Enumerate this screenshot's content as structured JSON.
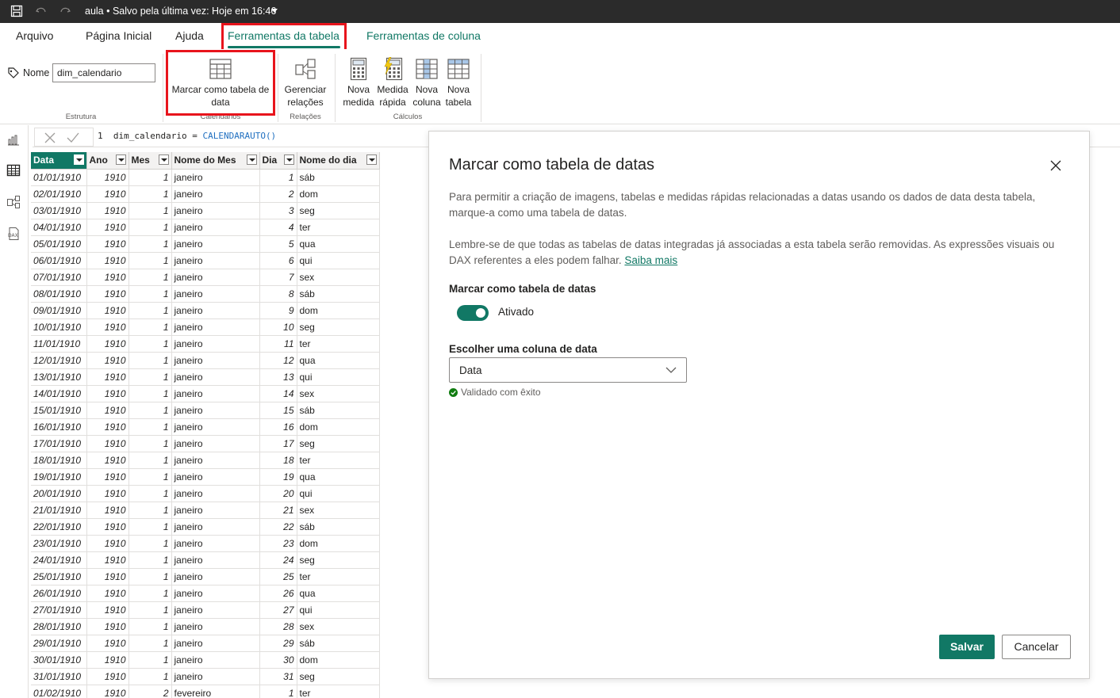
{
  "titlebar": {
    "title": "aula • Salvo pela última vez: Hoje em 16:46"
  },
  "tabs": [
    {
      "label": "Arquivo"
    },
    {
      "label": "Página Inicial"
    },
    {
      "label": "Ajuda"
    },
    {
      "label": "Ferramentas da tabela"
    },
    {
      "label": "Ferramentas de coluna"
    }
  ],
  "ribbon": {
    "name_label": "Nome",
    "name_value": "dim_calendario",
    "groups": {
      "estrutura": "Estrutura",
      "calendarios": "Calendários",
      "relacoes": "Relações",
      "calculos": "Cálculos"
    },
    "buttons": {
      "mark_date": "Marcar como tabela de data",
      "manage_rel": "Gerenciar relações",
      "new_measure": "Nova medida",
      "quick_measure": "Medida rápida",
      "new_column": "Nova coluna",
      "new_table": "Nova tabela"
    }
  },
  "formula": {
    "line": "1",
    "text": "dim_calendario = ",
    "fn": "CALENDARAUTO()"
  },
  "grid": {
    "columns": [
      "Data",
      "Ano",
      "Mes",
      "Nome do Mes",
      "Dia",
      "Nome do dia"
    ],
    "rows": [
      [
        "01/01/1910",
        "1910",
        "1",
        "janeiro",
        "1",
        "sáb"
      ],
      [
        "02/01/1910",
        "1910",
        "1",
        "janeiro",
        "2",
        "dom"
      ],
      [
        "03/01/1910",
        "1910",
        "1",
        "janeiro",
        "3",
        "seg"
      ],
      [
        "04/01/1910",
        "1910",
        "1",
        "janeiro",
        "4",
        "ter"
      ],
      [
        "05/01/1910",
        "1910",
        "1",
        "janeiro",
        "5",
        "qua"
      ],
      [
        "06/01/1910",
        "1910",
        "1",
        "janeiro",
        "6",
        "qui"
      ],
      [
        "07/01/1910",
        "1910",
        "1",
        "janeiro",
        "7",
        "sex"
      ],
      [
        "08/01/1910",
        "1910",
        "1",
        "janeiro",
        "8",
        "sáb"
      ],
      [
        "09/01/1910",
        "1910",
        "1",
        "janeiro",
        "9",
        "dom"
      ],
      [
        "10/01/1910",
        "1910",
        "1",
        "janeiro",
        "10",
        "seg"
      ],
      [
        "11/01/1910",
        "1910",
        "1",
        "janeiro",
        "11",
        "ter"
      ],
      [
        "12/01/1910",
        "1910",
        "1",
        "janeiro",
        "12",
        "qua"
      ],
      [
        "13/01/1910",
        "1910",
        "1",
        "janeiro",
        "13",
        "qui"
      ],
      [
        "14/01/1910",
        "1910",
        "1",
        "janeiro",
        "14",
        "sex"
      ],
      [
        "15/01/1910",
        "1910",
        "1",
        "janeiro",
        "15",
        "sáb"
      ],
      [
        "16/01/1910",
        "1910",
        "1",
        "janeiro",
        "16",
        "dom"
      ],
      [
        "17/01/1910",
        "1910",
        "1",
        "janeiro",
        "17",
        "seg"
      ],
      [
        "18/01/1910",
        "1910",
        "1",
        "janeiro",
        "18",
        "ter"
      ],
      [
        "19/01/1910",
        "1910",
        "1",
        "janeiro",
        "19",
        "qua"
      ],
      [
        "20/01/1910",
        "1910",
        "1",
        "janeiro",
        "20",
        "qui"
      ],
      [
        "21/01/1910",
        "1910",
        "1",
        "janeiro",
        "21",
        "sex"
      ],
      [
        "22/01/1910",
        "1910",
        "1",
        "janeiro",
        "22",
        "sáb"
      ],
      [
        "23/01/1910",
        "1910",
        "1",
        "janeiro",
        "23",
        "dom"
      ],
      [
        "24/01/1910",
        "1910",
        "1",
        "janeiro",
        "24",
        "seg"
      ],
      [
        "25/01/1910",
        "1910",
        "1",
        "janeiro",
        "25",
        "ter"
      ],
      [
        "26/01/1910",
        "1910",
        "1",
        "janeiro",
        "26",
        "qua"
      ],
      [
        "27/01/1910",
        "1910",
        "1",
        "janeiro",
        "27",
        "qui"
      ],
      [
        "28/01/1910",
        "1910",
        "1",
        "janeiro",
        "28",
        "sex"
      ],
      [
        "29/01/1910",
        "1910",
        "1",
        "janeiro",
        "29",
        "sáb"
      ],
      [
        "30/01/1910",
        "1910",
        "1",
        "janeiro",
        "30",
        "dom"
      ],
      [
        "31/01/1910",
        "1910",
        "1",
        "janeiro",
        "31",
        "seg"
      ],
      [
        "01/02/1910",
        "1910",
        "2",
        "fevereiro",
        "1",
        "ter"
      ]
    ]
  },
  "dialog": {
    "title": "Marcar como tabela de datas",
    "p1": "Para permitir a criação de imagens, tabelas e medidas rápidas relacionadas a datas usando os dados de data desta tabela, marque-a como uma tabela de datas.",
    "p2": "Lembre-se de que todas as tabelas de datas integradas já associadas a esta tabela serão removidas. As expressões visuais ou DAX referentes a eles podem falhar.",
    "p2_link": "Saiba mais",
    "toggle_title": "Marcar como tabela de datas",
    "toggle_state": "Ativado",
    "select_label": "Escolher uma coluna de data",
    "select_value": "Data",
    "validation": "Validado com êxito",
    "save": "Salvar",
    "cancel": "Cancelar"
  },
  "colors": {
    "accent": "#117865",
    "highlight": "#e8141c"
  }
}
